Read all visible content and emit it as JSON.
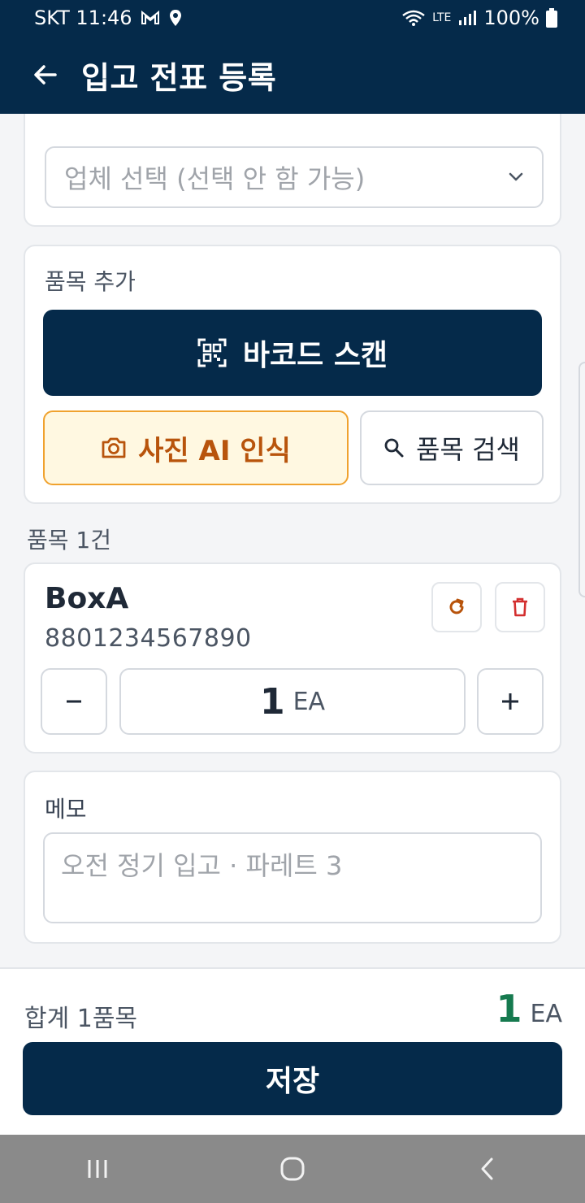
{
  "status_bar": {
    "carrier_time": "SKT 11:46",
    "network": "LTE",
    "battery": "100%"
  },
  "app_bar": {
    "title": "입고 전표 등록"
  },
  "supplier": {
    "placeholder": "업체 선택 (선택 안 함 가능)"
  },
  "add_item": {
    "label": "품목 추가",
    "scan_label": "바코드 스캔",
    "ai_label": "사진 AI 인식",
    "search_label": "품목 검색"
  },
  "items": {
    "count_label": "품목 1건",
    "list": [
      {
        "name": "BoxA",
        "code": "8801234567890",
        "qty": "1",
        "unit": "EA"
      }
    ]
  },
  "memo": {
    "label": "메모",
    "placeholder": "오전 정기 입고 · 파레트 3"
  },
  "summary": {
    "total_label": "합계 1품목",
    "total_qty": "1",
    "total_unit": "EA",
    "save_label": "저장"
  },
  "colors": {
    "primary": "#052a4a",
    "accent_orange": "#b8540c",
    "total_green": "#167a4f",
    "delete_red": "#d32f2f"
  }
}
